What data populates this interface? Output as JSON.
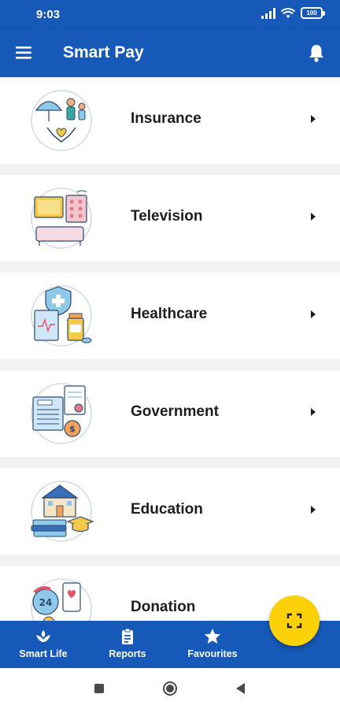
{
  "status_bar": {
    "time": "9:03",
    "battery": "100",
    "icons": [
      "signal-icon",
      "wifi-icon",
      "battery-icon"
    ]
  },
  "app_bar": {
    "title": "Smart Pay",
    "left_icon": "menu-icon",
    "right_icon": "bell-icon"
  },
  "categories": [
    {
      "label": "Insurance",
      "icon": "insurance-illustration"
    },
    {
      "label": "Television",
      "icon": "television-illustration"
    },
    {
      "label": "Healthcare",
      "icon": "healthcare-illustration"
    },
    {
      "label": "Government",
      "icon": "government-illustration"
    },
    {
      "label": "Education",
      "icon": "education-illustration"
    },
    {
      "label": "Donation",
      "icon": "donation-illustration"
    }
  ],
  "fab": {
    "icon": "scan-icon"
  },
  "bottom_nav": {
    "items": [
      {
        "label": "Smart Life",
        "icon": "smart-life-icon"
      },
      {
        "label": "Reports",
        "icon": "reports-icon"
      },
      {
        "label": "Favourites",
        "icon": "star-icon"
      }
    ]
  },
  "system_nav": [
    "square-icon",
    "circle-icon",
    "back-triangle-icon"
  ],
  "colors": {
    "primary": "#1659b8",
    "fab": "#fdd10a",
    "background": "#f2f2f2",
    "card": "#ffffff",
    "text": "#1e1e1e"
  }
}
